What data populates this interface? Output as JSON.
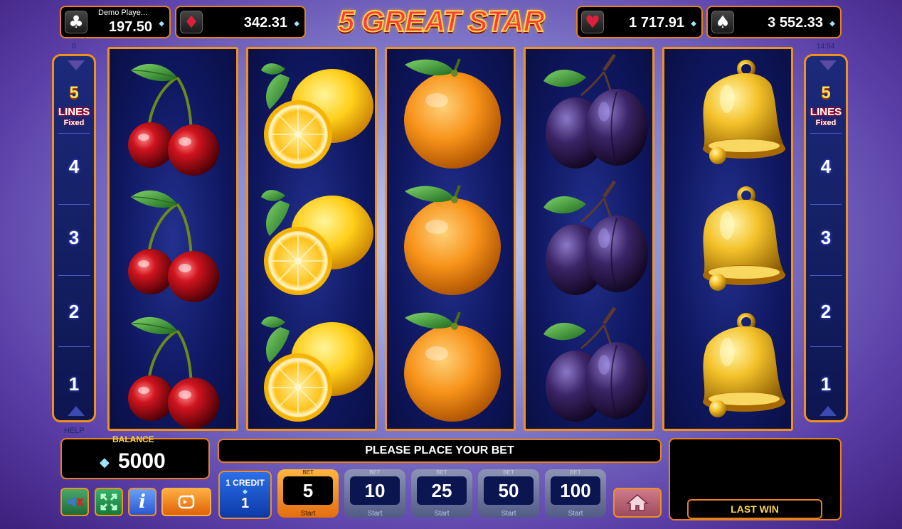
{
  "header": {
    "title": "5 GREAT STAR",
    "jackpots": [
      {
        "suit": "club-icon",
        "glyph": "♣",
        "player": "Demo Playe...",
        "value": "197.50",
        "suit_color": "#ffffff"
      },
      {
        "suit": "diamond-icon",
        "glyph": "♦",
        "value": "342.31",
        "suit_color": "#e0203a"
      },
      {
        "suit": "heart-icon",
        "glyph": "♥",
        "value": "1 717.91",
        "suit_color": "#e0203a"
      },
      {
        "suit": "spade-icon",
        "glyph": "♠",
        "value": "3 552.33",
        "suit_color": "#ffffff"
      }
    ],
    "left_counter": "0",
    "clock": "14:54"
  },
  "lines_panel": {
    "count": "5",
    "label": "LINES",
    "fixed": "Fixed",
    "numbers": [
      "4",
      "3",
      "2",
      "1"
    ]
  },
  "reels": [
    [
      "cherry",
      "cherry",
      "cherry"
    ],
    [
      "lemon",
      "lemon",
      "lemon"
    ],
    [
      "orange",
      "orange",
      "orange"
    ],
    [
      "plum",
      "plum",
      "plum"
    ],
    [
      "bell",
      "bell",
      "bell"
    ]
  ],
  "bottom": {
    "help_label": "HELP",
    "balance_label": "BALANCE",
    "balance_value": "5000",
    "message": "PLEASE PLACE YOUR BET",
    "credit_label": "1 CREDIT",
    "credit_value": "1",
    "bet_label": "BET",
    "start_label": "Start",
    "bets": [
      "5",
      "10",
      "25",
      "50",
      "100"
    ],
    "selected_bet": "5",
    "last_win_label": "LAST WIN"
  },
  "colors": {
    "accent_orange": "#f0901d",
    "reel_bg": "#0f1760",
    "gold_text": "#ffd54a"
  }
}
